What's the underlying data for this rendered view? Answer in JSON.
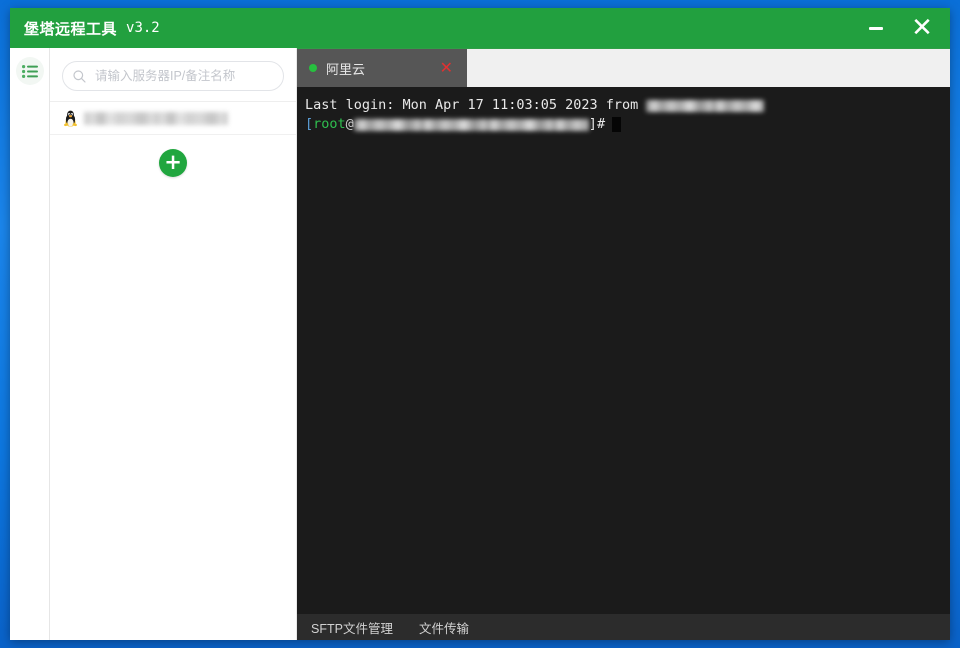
{
  "window": {
    "title": "堡塔远程工具",
    "version": "v3.2",
    "minimize_label": "−",
    "close_label": "✕",
    "minimize_icon": "minimize-icon",
    "close_icon": "close-icon"
  },
  "sidebar": {
    "menu_icon": "list-menu-icon",
    "search": {
      "placeholder": "请输入服务器IP/备注名称",
      "value": "",
      "icon": "search-icon"
    },
    "servers": [
      {
        "icon": "linux-penguin-icon",
        "name": "",
        "redacted": true
      }
    ],
    "add_button": {
      "label": "+",
      "icon": "plus-icon"
    }
  },
  "tabs": [
    {
      "label": "阿里云",
      "status_icon": "green-status-dot-icon",
      "close_icon": "close-icon",
      "close_label": "✕",
      "active": true
    }
  ],
  "terminal": {
    "lines": [
      {
        "prefix": "Last login: Mon Apr 17 11:03:05 2023 from ",
        "redacted_tail": true
      }
    ],
    "prompt": {
      "open_bracket": "[",
      "user": "root",
      "at": "@",
      "host_redacted": true,
      "close_bracket": "]",
      "symbol": "#"
    },
    "cursor_icon": "text-cursor-block"
  },
  "bottom_bar": {
    "items": [
      {
        "label": "SFTP文件管理"
      },
      {
        "label": "文件传输"
      }
    ]
  },
  "colors": {
    "brand_green": "#22a03f",
    "accent_green": "#21a63f",
    "tab_active_bg": "#565656",
    "terminal_bg": "#1b1b1b",
    "close_red": "#e03131",
    "desktop_blue": "#1b86ec"
  }
}
